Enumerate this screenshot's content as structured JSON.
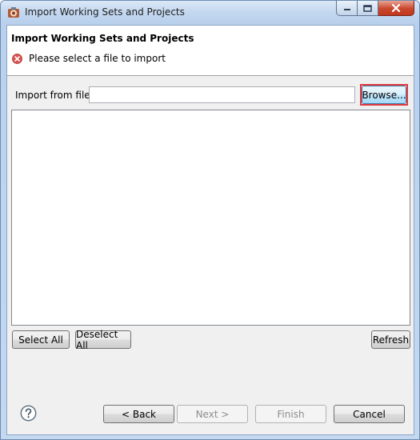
{
  "window": {
    "title": "Import Working Sets and Projects",
    "icon": "eclipse-import-icon"
  },
  "banner": {
    "title": "Import Working Sets and Projects",
    "message": "Please select a file to import",
    "message_icon": "error-icon"
  },
  "import": {
    "label": "Import from file:",
    "value": "",
    "browse_label": "Browse..."
  },
  "project_list": {
    "items": []
  },
  "selection_buttons": {
    "select_all": "Select All",
    "deselect_all": "Deselect All",
    "refresh": "Refresh"
  },
  "footer": {
    "help_icon": "help-icon",
    "back": "< Back",
    "next": "Next >",
    "finish": "Finish",
    "cancel": "Cancel"
  },
  "colors": {
    "highlight": "#e0393e",
    "error": "#d9534f"
  }
}
